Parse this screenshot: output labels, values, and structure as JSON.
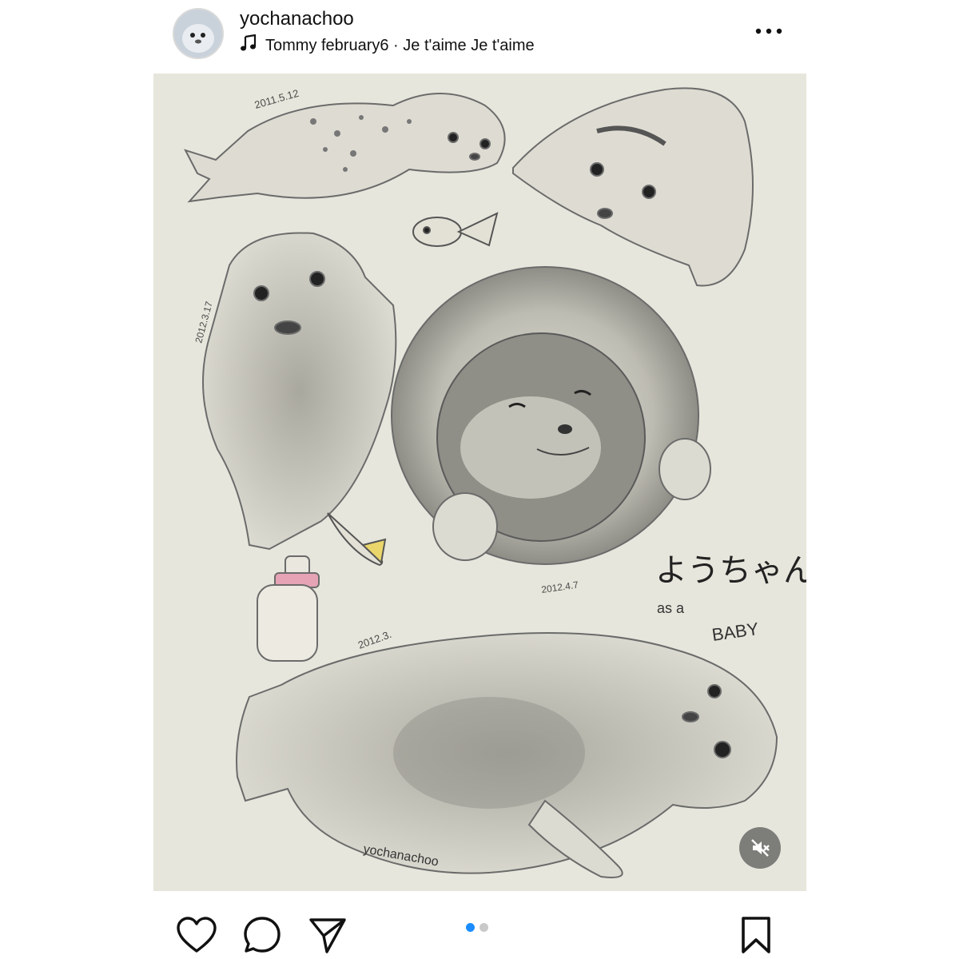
{
  "post": {
    "username": "yochanachoo",
    "music": {
      "icon": "music-note-icon",
      "label": "Tommy february6 · Je t'aime Je t'aime"
    }
  },
  "media": {
    "artwork": {
      "date_labels": [
        "2011.5.12",
        "2012.3.17",
        "2012.4.7",
        "2012.3."
      ],
      "caption_jp": "ようちゃん",
      "caption_as_a": "as a",
      "caption_baby": "BABY",
      "signature": "yochanachoo"
    },
    "mute_icon": "volume-muted-icon"
  },
  "actions": {
    "like_icon": "heart-icon",
    "comment_icon": "comment-icon",
    "share_icon": "send-icon",
    "save_icon": "bookmark-icon"
  },
  "carousel": {
    "count": 2,
    "active_index": 0
  },
  "colors": {
    "paper": "#e7e6dc",
    "pencil": "#6b6b6b",
    "accent_dot": "#1a8cff",
    "bottle_pink": "#e6a3b6",
    "fish_yellow": "#ead66a"
  }
}
